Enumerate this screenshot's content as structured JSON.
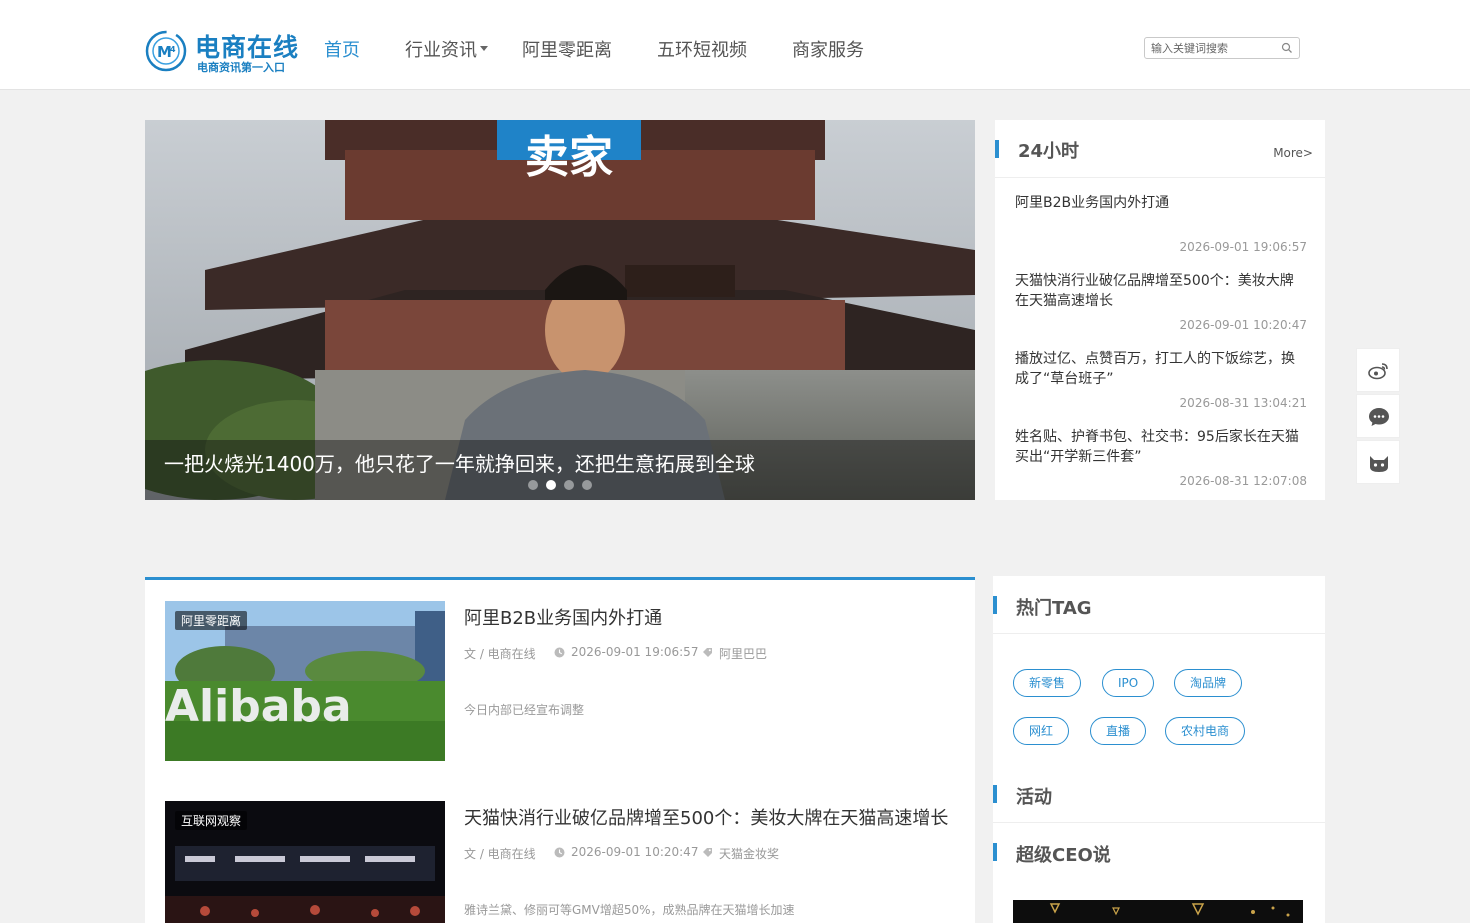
{
  "header": {
    "logo_title": "电商在线",
    "logo_sub": "电商资讯第一入口",
    "nav": [
      "首页",
      "行业资讯",
      "阿里零距离",
      "五环短视频",
      "商家服务"
    ],
    "search_placeholder": "输入关键词搜索"
  },
  "slider": {
    "caption": "一把火烧光1400万，他只花了一年就挣回来，还把生意拓展到全球",
    "banner_text": "卖家",
    "active_dot": 1
  },
  "panel24": {
    "title": "24小时",
    "more": "More>",
    "items": [
      {
        "title": "阿里B2B业务国内外打通",
        "date": "2026-09-01 19:06:57"
      },
      {
        "title": "天猫快消行业破亿品牌增至500个：美妆大牌在天猫高速增长",
        "date": "2026-09-01 10:20:47"
      },
      {
        "title": "播放过亿、点赞百万，打工人的下饭综艺，换成了“草台班子”",
        "date": "2026-08-31 13:04:21"
      },
      {
        "title": "姓名贴、护脊书包、社交书：95后家长在天猫买出“开学新三件套”",
        "date": "2026-08-31 12:07:08"
      }
    ]
  },
  "articles": [
    {
      "tag": "阿里零距离",
      "title": "阿里B2B业务国内外打通",
      "author": "文 / 电商在线",
      "date": "2026-09-01 19:06:57",
      "keyword": "阿里巴巴",
      "desc": "今日内部已经宣布调整",
      "thumb_text": "Alibaba"
    },
    {
      "tag": "互联网观察",
      "title": "天猫快消行业破亿品牌增至500个：美妆大牌在天猫高速增长",
      "author": "文 / 电商在线",
      "date": "2026-09-01 10:20:47",
      "keyword": "天猫金妆奖",
      "desc": "雅诗兰黛、修丽可等GMV增超50%，成熟品牌在天猫增长加速"
    }
  ],
  "sidebar": {
    "hot_tag_title": "热门TAG",
    "tags": [
      "新零售",
      "IPO",
      "淘品牌",
      "网红",
      "直播",
      "农村电商"
    ],
    "activity_title": "活动",
    "ceo_title": "超级CEO说"
  },
  "colors": {
    "accent": "#2b8fd0",
    "logo": "#1a7fc1"
  },
  "icons": [
    "search-icon",
    "weibo-icon",
    "chat-icon",
    "mascot-icon",
    "clock-icon",
    "tag-icon"
  ]
}
